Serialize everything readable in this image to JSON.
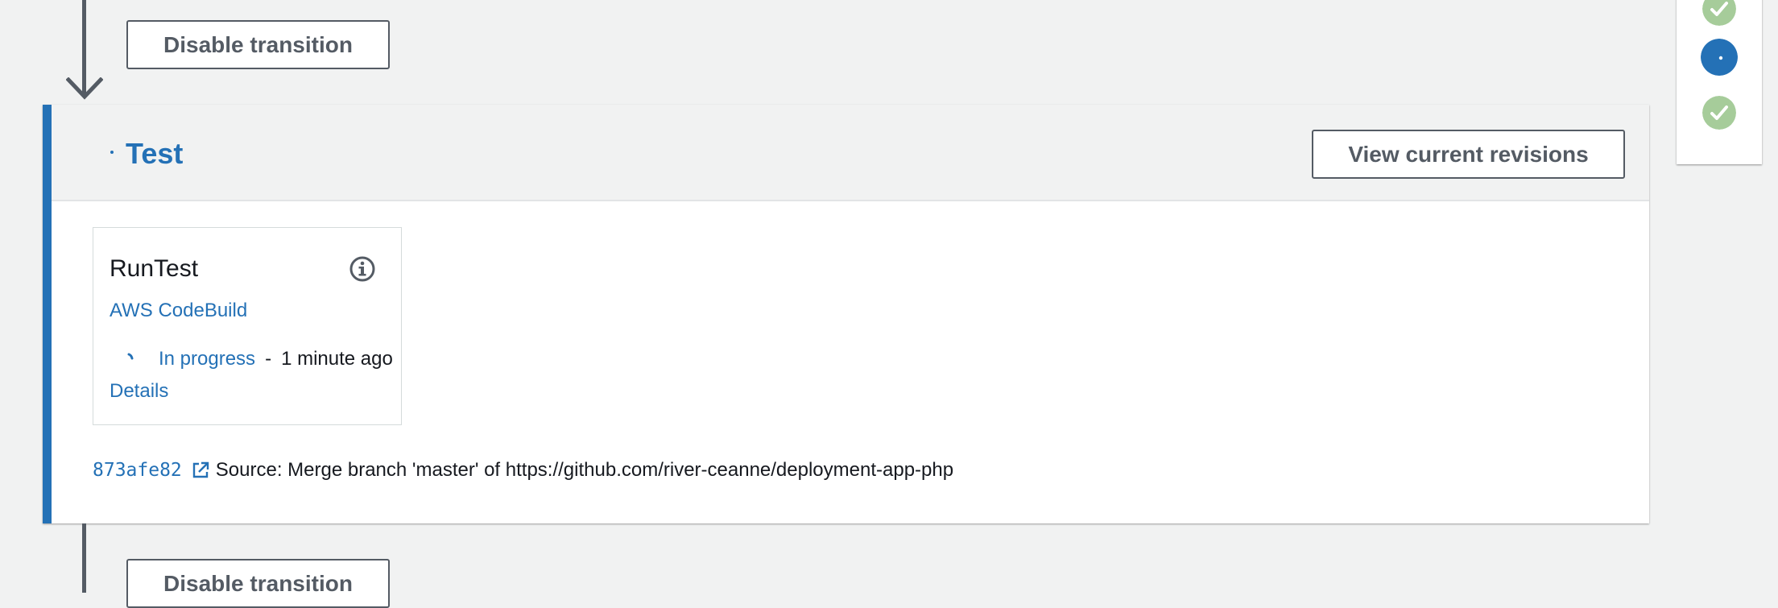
{
  "transitions": {
    "top_button_label": "Disable transition",
    "bottom_button_label": "Disable transition"
  },
  "stage": {
    "title": "Test",
    "view_revisions_label": "View current revisions",
    "status": "in-progress"
  },
  "action": {
    "name": "RunTest",
    "provider": "AWS CodeBuild",
    "status_label": "In progress",
    "separator": "-",
    "time": "1 minute ago",
    "details_label": "Details"
  },
  "revision": {
    "commit_id": "873afe82",
    "message": "Source: Merge branch 'master' of https://github.com/river-ceanne/deployment-app-php"
  },
  "side_steps": [
    {
      "status": "succeeded",
      "icon": "check-circle-icon"
    },
    {
      "status": "in-progress",
      "icon": "spinner-icon"
    },
    {
      "status": "succeeded",
      "icon": "check-circle-icon"
    }
  ],
  "colors": {
    "accent": "#2471b6",
    "success": "#a6cc9a",
    "text": "#16191f",
    "border": "#545b64",
    "background": "#f1f2f2"
  }
}
